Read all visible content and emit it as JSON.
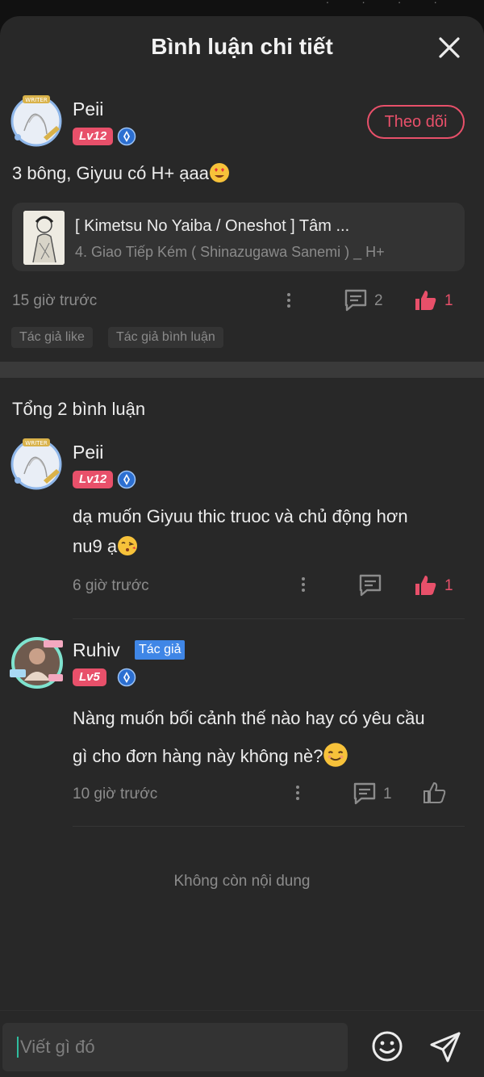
{
  "header": {
    "title": "Bình luận chi tiết"
  },
  "main_comment": {
    "username": "Peii",
    "level": "Lv12",
    "follow_label": "Theo dõi",
    "text": "3 bông, Giyuu có H+ ạaa",
    "story": {
      "title": "[ Kimetsu No Yaiba / Oneshot ] Tâm ...",
      "chapter": "4. Giao Tiếp Kém ( Shinazugawa Sanemi ) _ H+"
    },
    "time": "15 giờ trước",
    "reply_count": "2",
    "like_count": "1",
    "tags": [
      "Tác giả like",
      "Tác giả bình luận"
    ]
  },
  "replies_section": {
    "total_label": "Tổng 2 bình luận",
    "replies": [
      {
        "username": "Peii",
        "level": "Lv12",
        "text_line1": "dạ muốn Giyuu thic truoc và chủ động hơn",
        "text_line2": "nu9 ạ",
        "time": "6 giờ trước",
        "like_count": "1"
      },
      {
        "username": "Ruhiv",
        "author_badge": "Tác giả",
        "level": "Lv5",
        "text_line1": "Nàng muốn bối cảnh thế nào hay có yêu cầu",
        "text_line2": "gì cho đơn hàng này không nè?",
        "time": "10 giờ trước",
        "reply_count": "1"
      }
    ],
    "end_label": "Không còn nội dung"
  },
  "composer": {
    "placeholder": "Viết gì đó"
  },
  "colors": {
    "accent": "#e8506a",
    "author_badge": "#3f86e6",
    "background": "#282828"
  }
}
